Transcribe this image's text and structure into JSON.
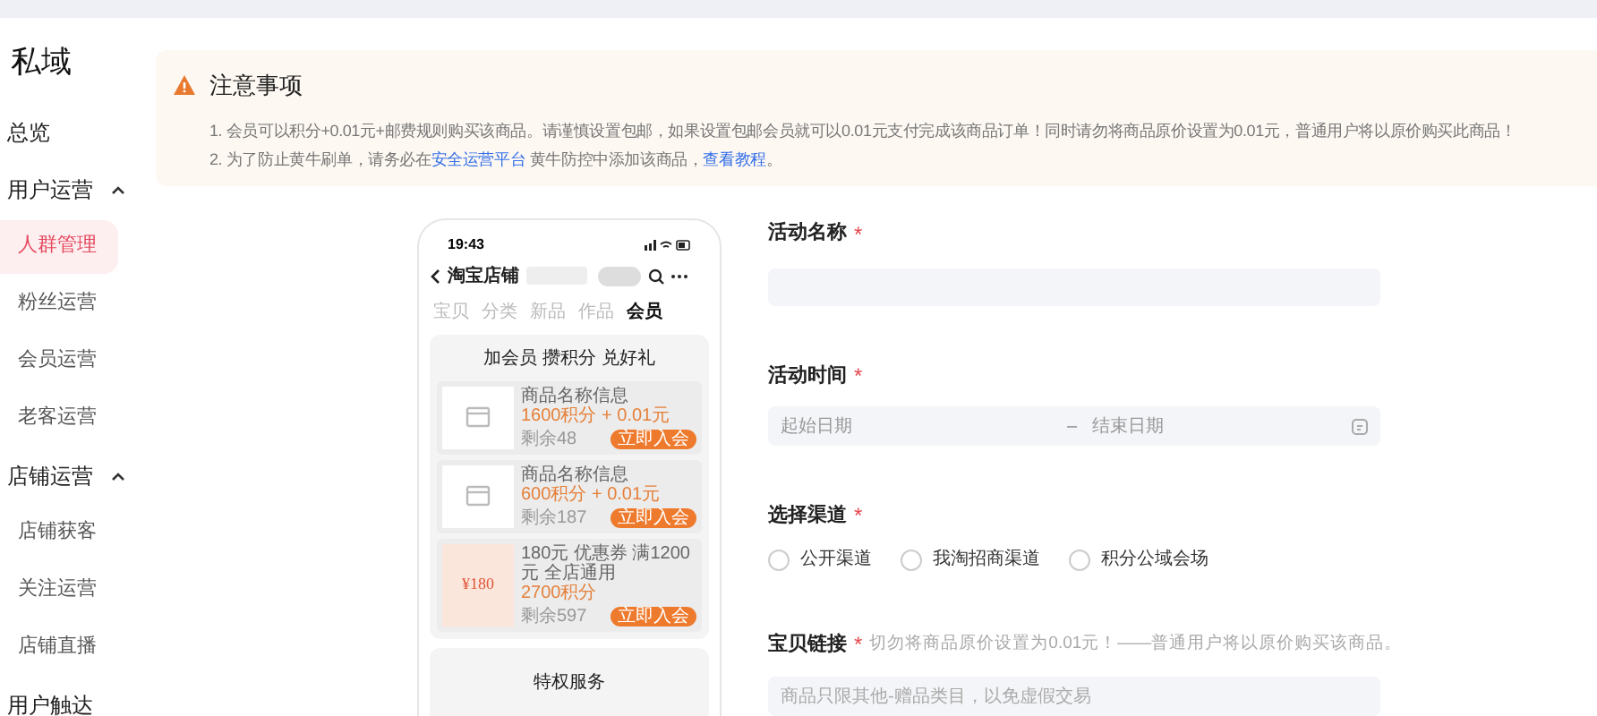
{
  "sidebar": {
    "title": "私域",
    "items": [
      {
        "label": "总览"
      },
      {
        "label": "用户运营",
        "expanded": true,
        "children": [
          {
            "label": "人群管理",
            "selected": true
          },
          {
            "label": "粉丝运营",
            "selected": false
          },
          {
            "label": "会员运营",
            "selected": false
          },
          {
            "label": "老客运营",
            "selected": false
          }
        ]
      },
      {
        "label": "店铺运营",
        "expanded": true,
        "children": [
          {
            "label": "店铺获客",
            "selected": false
          },
          {
            "label": "关注运营",
            "selected": false
          },
          {
            "label": "店铺直播",
            "selected": false
          }
        ]
      },
      {
        "label": "用户触达"
      }
    ]
  },
  "notice": {
    "title": "注意事项",
    "lines": [
      [
        {
          "text": "1. 会员可以积分+0.01元+邮费规则购买该商品。请谨慎设置包邮，如果设置包邮会员就可以0.01元支付完成该商品订单！同时请勿将商品原价设置为0.01元，普通用户将以原价购买此商品！",
          "kind": "text"
        }
      ],
      [
        {
          "text": "2. 为了防止黄牛刷单，请务必在",
          "kind": "text"
        },
        {
          "text": "安全运营平台",
          "kind": "link"
        },
        {
          "text": " 黄牛防控中添加该商品，",
          "kind": "text"
        },
        {
          "text": "查看教程",
          "kind": "link"
        },
        {
          "text": "。",
          "kind": "text"
        }
      ]
    ]
  },
  "phone": {
    "time": "19:43",
    "store": "淘宝店铺",
    "tabs": [
      {
        "label": "宝贝",
        "selected": false
      },
      {
        "label": "分类",
        "selected": false
      },
      {
        "label": "新品",
        "selected": false
      },
      {
        "label": "作品",
        "selected": false
      },
      {
        "label": "会员",
        "selected": true
      }
    ],
    "card_title": "加会员 攒积分 兑好礼",
    "products": [
      {
        "kind": "image",
        "name": "商品名称信息",
        "price": "1600积分 + 0.01元",
        "stock": "剩余48",
        "button": "立即入会"
      },
      {
        "kind": "image",
        "name": "商品名称信息",
        "price": "600积分 + 0.01元",
        "stock": "剩余187",
        "button": "立即入会"
      },
      {
        "kind": "coupon",
        "coupon": "¥180",
        "name": "180元 优惠券 满1200元 全店通用",
        "price": "2700积分",
        "stock": "剩余597",
        "button": "立即入会"
      }
    ],
    "section_title": "特权服务"
  },
  "form": {
    "name": {
      "label": "活动名称",
      "mark": "*"
    },
    "time": {
      "label": "活动时间",
      "mark": "*",
      "start_placeholder": "起始日期",
      "separator": "–",
      "end_placeholder": "结束日期"
    },
    "channel": {
      "label": "选择渠道",
      "mark": "*",
      "options": [
        {
          "label": "公开渠道",
          "selected": false
        },
        {
          "label": "我淘招商渠道",
          "selected": false
        },
        {
          "label": "积分公域会场",
          "selected": false
        }
      ]
    },
    "link": {
      "label": "宝贝链接",
      "mark": "*",
      "hint": "切勿将商品原价设置为0.01元！——普通用户将以原价购买该商品。",
      "placeholder": "商品只限其他-赠品类目，以免虚假交易"
    }
  }
}
